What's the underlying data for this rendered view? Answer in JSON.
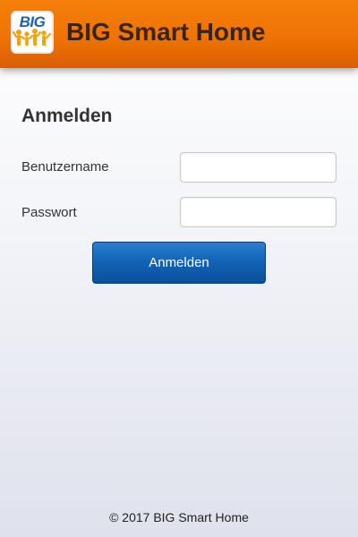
{
  "header": {
    "logo_text": "BIG",
    "title": "BIG Smart Home",
    "color": "#f07708"
  },
  "login": {
    "title": "Anmelden",
    "username_label": "Benutzername",
    "username_value": "",
    "password_label": "Passwort",
    "password_value": "",
    "submit_label": "Anmelden",
    "button_color": "#1264b8"
  },
  "footer": {
    "text": "© 2017 BIG Smart Home"
  }
}
